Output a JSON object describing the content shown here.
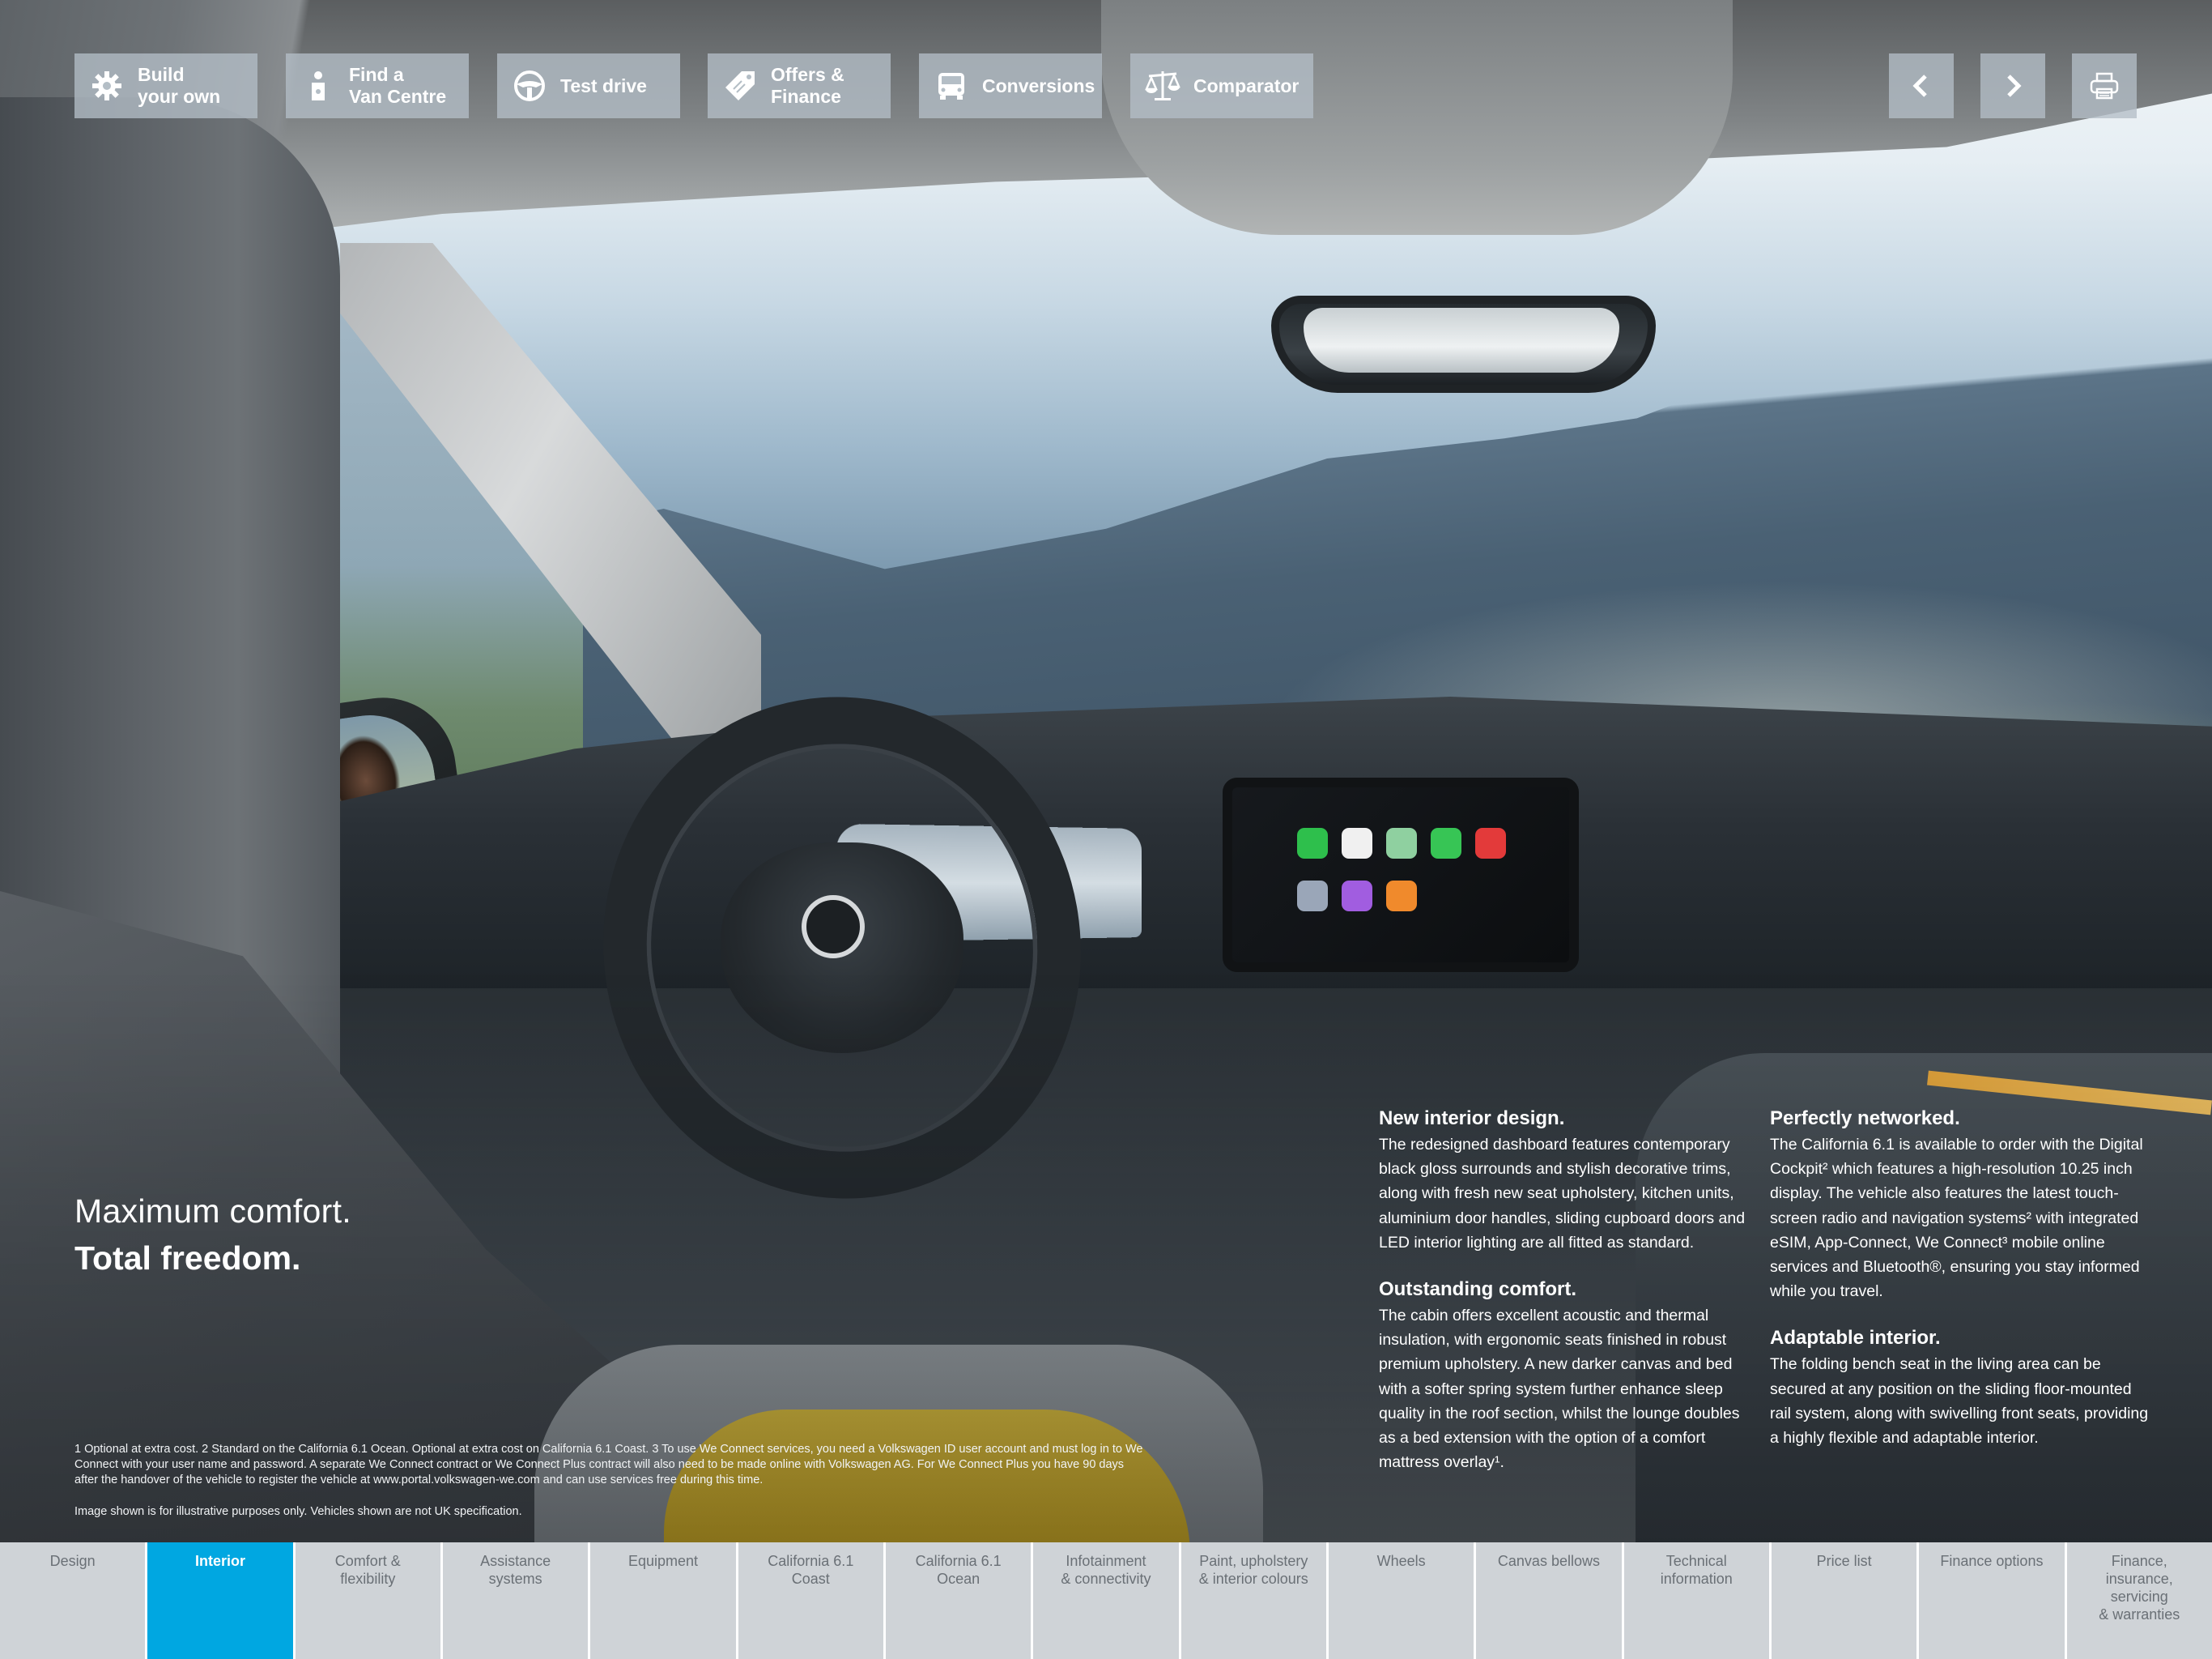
{
  "toolbar": {
    "buttons": [
      {
        "label": "Build\nyour own",
        "icon": "gear-icon"
      },
      {
        "label": "Find a\nVan Centre",
        "icon": "location-person-icon"
      },
      {
        "label": "Test drive",
        "icon": "steering-wheel-icon"
      },
      {
        "label": "Offers &\nFinance",
        "icon": "price-tag-icon"
      },
      {
        "label": "Conversions",
        "icon": "van-front-icon"
      },
      {
        "label": "Comparator",
        "icon": "scales-icon"
      }
    ],
    "nav": {
      "previous_icon": "chevron-left-icon",
      "next_icon": "chevron-right-icon",
      "print_icon": "printer-icon"
    }
  },
  "headline": {
    "line1": "Maximum comfort.",
    "line2": "Total freedom."
  },
  "columns": {
    "left": [
      {
        "title": "New interior design.",
        "body": "The redesigned dashboard features contemporary black gloss surrounds and stylish decorative trims, along with fresh new seat upholstery, kitchen units, aluminium door handles, sliding cupboard doors and LED interior lighting are all fitted as standard."
      },
      {
        "title": "Outstanding comfort.",
        "body": "The cabin offers excellent acoustic and thermal insulation, with ergonomic seats finished in robust premium upholstery. A new darker canvas and bed with a softer spring system further enhance sleep quality in the roof section, whilst the lounge doubles as a bed extension with the option of a comfort mattress overlay¹."
      }
    ],
    "right": [
      {
        "title": "Perfectly networked.",
        "body": "The California 6.1 is available to order with the Digital Cockpit² which features a high-resolution 10.25 inch display. The vehicle also features the latest touch-screen radio and navigation systems² with integrated eSIM, App-Connect, We Connect³ mobile online services and Bluetooth®, ensuring you stay informed while you travel."
      },
      {
        "title": "Adaptable interior.",
        "body": "The folding bench seat in the living area can be secured at any position on the sliding floor-mounted rail system, along with swivelling front seats, providing a highly flexible and adaptable interior."
      }
    ]
  },
  "footnotes": {
    "main": "1 Optional at extra cost.    2 Standard on the California 6.1 Ocean. Optional at extra cost on California 6.1 Coast.    3 To use We Connect services, you need a Volkswagen ID user account and must log in to We Connect with your user name and password. A separate We Connect contract or We Connect Plus contract will also need to be made online with Volkswagen AG. For We Connect Plus you have 90 days after the handover of the vehicle to register the vehicle at www.portal.volkswagen-we.com and can use services free during this time.",
    "image": "Image shown is for illustrative purposes only. Vehicles shown are not UK specification."
  },
  "bottom_nav": {
    "active_color": "#00a7e1",
    "items": [
      {
        "label": "Design",
        "active": false
      },
      {
        "label": "Interior",
        "active": true
      },
      {
        "label": "Comfort &\nflexibility",
        "active": false
      },
      {
        "label": "Assistance\nsystems",
        "active": false
      },
      {
        "label": "Equipment",
        "active": false
      },
      {
        "label": "California 6.1\nCoast",
        "active": false
      },
      {
        "label": "California 6.1\nOcean",
        "active": false
      },
      {
        "label": "Infotainment\n& connectivity",
        "active": false
      },
      {
        "label": "Paint, upholstery\n& interior colours",
        "active": false
      },
      {
        "label": "Wheels",
        "active": false
      },
      {
        "label": "Canvas bellows",
        "active": false
      },
      {
        "label": "Technical\ninformation",
        "active": false
      },
      {
        "label": "Price list",
        "active": false
      },
      {
        "label": "Finance options",
        "active": false
      },
      {
        "label": "Finance,\ninsurance,\nservicing\n& warranties",
        "active": false
      }
    ]
  }
}
